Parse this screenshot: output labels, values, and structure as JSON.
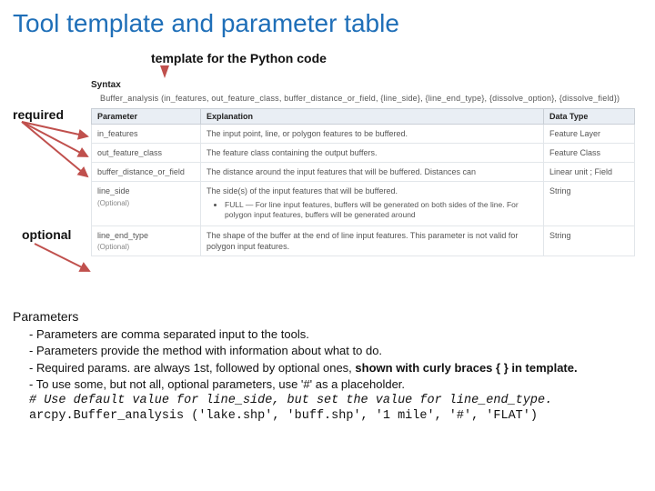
{
  "title": "Tool template and parameter table",
  "subtitle": "template for the Python code",
  "label_required": "required",
  "label_optional": "optional",
  "syntax": {
    "heading": "Syntax",
    "body": "Buffer_analysis (in_features, out_feature_class, buffer_distance_or_field, {line_side}, {line_end_type}, {dissolve_option}, {dissolve_field})"
  },
  "table": {
    "headers": {
      "p": "Parameter",
      "e": "Explanation",
      "d": "Data Type"
    },
    "rows": [
      {
        "p": "in_features",
        "e": "The input point, line, or polygon features to be buffered.",
        "d": "Feature Layer"
      },
      {
        "p": "out_feature_class",
        "e": "The feature class containing the output buffers.",
        "d": "Feature Class"
      },
      {
        "p": "buffer_distance_or_field",
        "e": "The distance around the input features that will be buffered. Distances can",
        "d": "Linear unit ; Field"
      },
      {
        "p": "line_side",
        "opt": "(Optional)",
        "e": "The side(s) of the input features that will be buffered.",
        "bullets": [
          "FULL — For line input features, buffers will be generated on both sides of the line. For polygon input features, buffers will be generated around"
        ],
        "d": "String"
      },
      {
        "p": "line_end_type",
        "opt": "(Optional)",
        "e": "The shape of the buffer at the end of line input features. This parameter is not valid for polygon input features.",
        "d": "String"
      }
    ]
  },
  "notes": {
    "heading": "Parameters",
    "line1": "- Parameters are comma separated input to the tools.",
    "line2": "- Parameters provide the method with information about what to do.",
    "line3a": "- Required params. are always 1st, followed by optional ones, ",
    "line3b": "shown with curly braces { } in template.",
    "line4": "-   To use some, but not all, optional parameters, use '#' as a placeholder.",
    "code_comment": "# Use default value for line_side, but set the value for line_end_type.",
    "code_call": "arcpy.Buffer_analysis ('lake.shp', 'buff.shp', '1 mile', '#', 'FLAT')"
  }
}
